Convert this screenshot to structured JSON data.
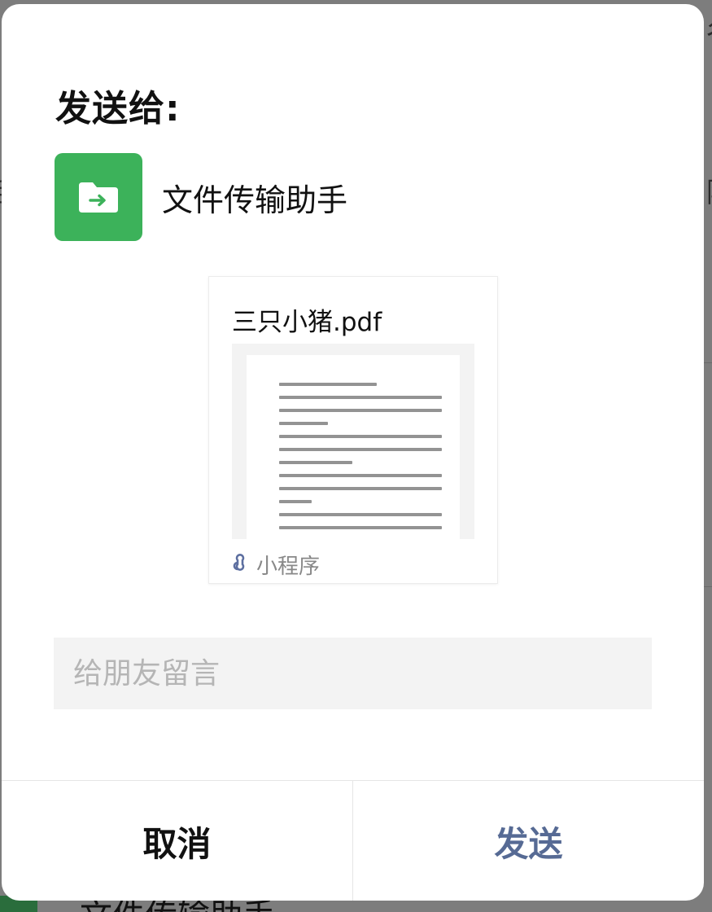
{
  "background": {
    "edge_fragments": [
      "话",
      "阿",
      "谷"
    ],
    "bottom_label": "文件传输助手"
  },
  "dialog": {
    "title": "发送给:",
    "recipient": {
      "name": "文件传输助手",
      "avatar_icon": "folder-transfer-icon",
      "avatar_color": "#3cb25a"
    },
    "card": {
      "title": "三只小猪.pdf",
      "preview_icon": "document-preview",
      "footer_icon": "mini-program-icon",
      "footer_label": "小程序"
    },
    "message": {
      "placeholder": "给朋友留言",
      "value": ""
    },
    "buttons": {
      "cancel": "取消",
      "send": "发送"
    },
    "colors": {
      "send_text": "#566a94",
      "accent_green": "#3cb25a"
    }
  }
}
